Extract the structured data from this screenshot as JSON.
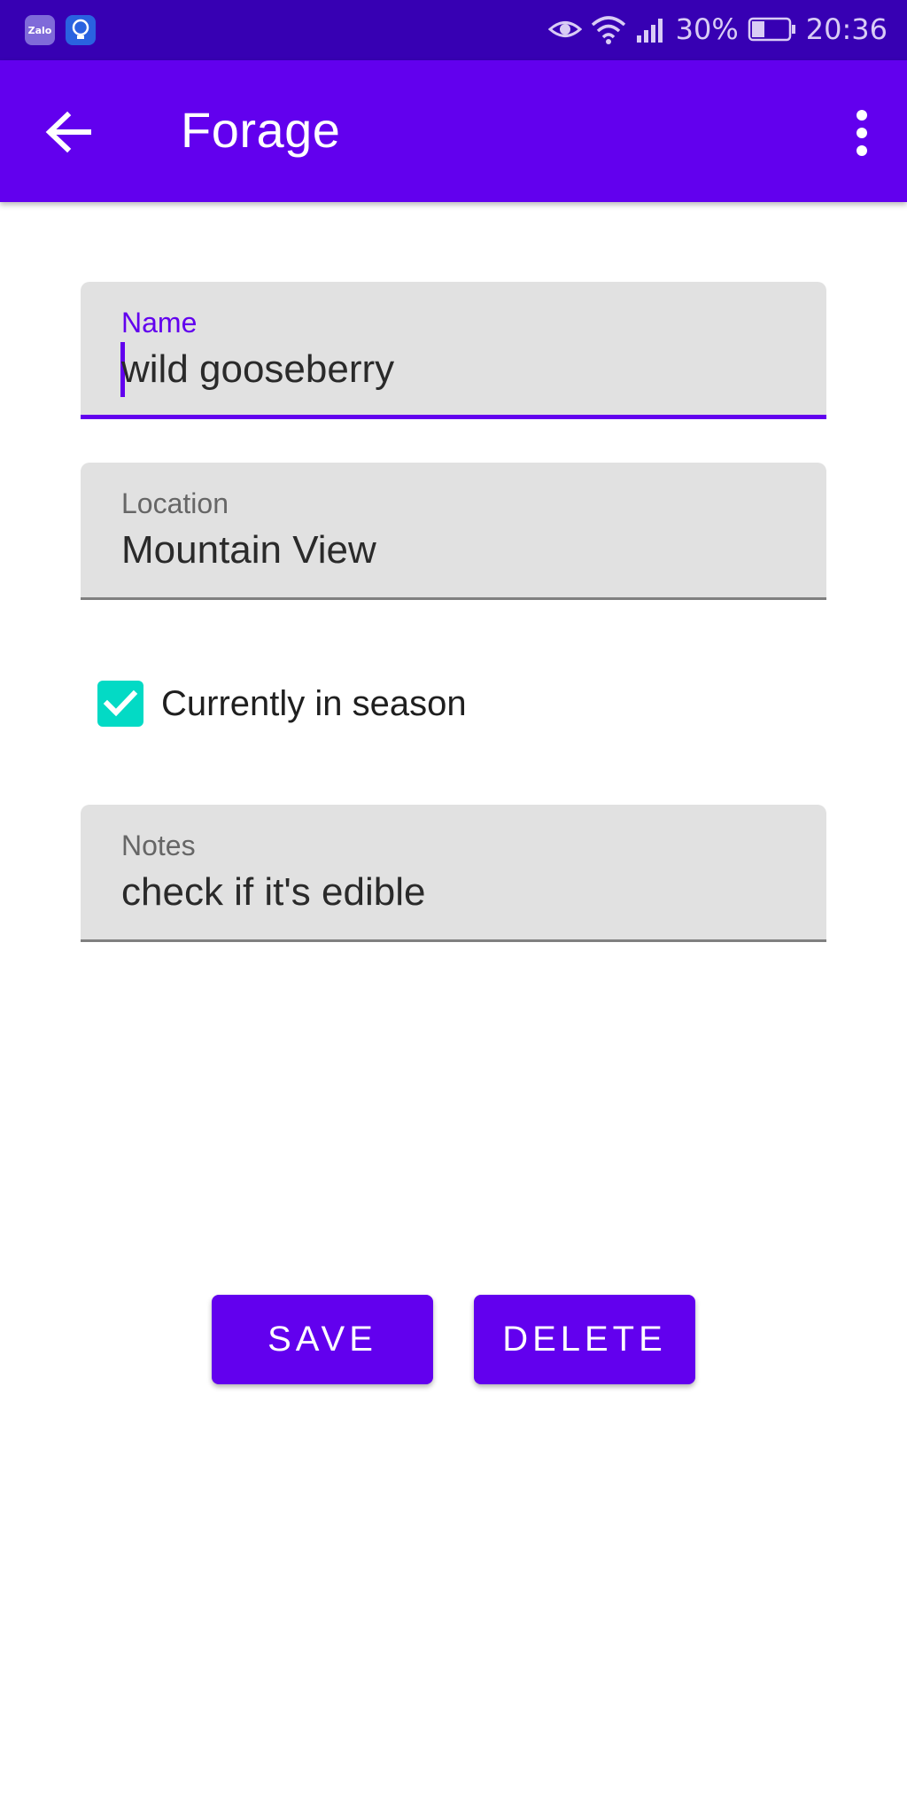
{
  "status_bar": {
    "left_icons": [
      {
        "icon": "zalo-app-icon",
        "text": "Zalo"
      },
      {
        "icon": "lightbulb-icon"
      }
    ],
    "right_icons": [
      "eye-comfort-icon",
      "wifi-icon",
      "cellular-signal-icon",
      "battery-icon"
    ],
    "battery": "30%",
    "time": "20:36"
  },
  "app_bar": {
    "title": "Forage",
    "back_icon": "arrow-back-icon",
    "menu_icon": "more-vert-icon",
    "color": "#6200ee"
  },
  "form": {
    "name": {
      "label": "Name",
      "value": "wild gooseberry",
      "focused": true
    },
    "location": {
      "label": "Location",
      "value": "Mountain View"
    },
    "in_season": {
      "label": "Currently in season",
      "checked": true
    },
    "notes": {
      "label": "Notes",
      "value": "check if it's edible"
    }
  },
  "actions": {
    "save_label": "SAVE",
    "delete_label": "DELETE"
  },
  "colors": {
    "primary": "#6200ee",
    "primary_dark": "#3700b3",
    "checkbox": "#03dac5",
    "field_bg": "#e1e1e1"
  }
}
